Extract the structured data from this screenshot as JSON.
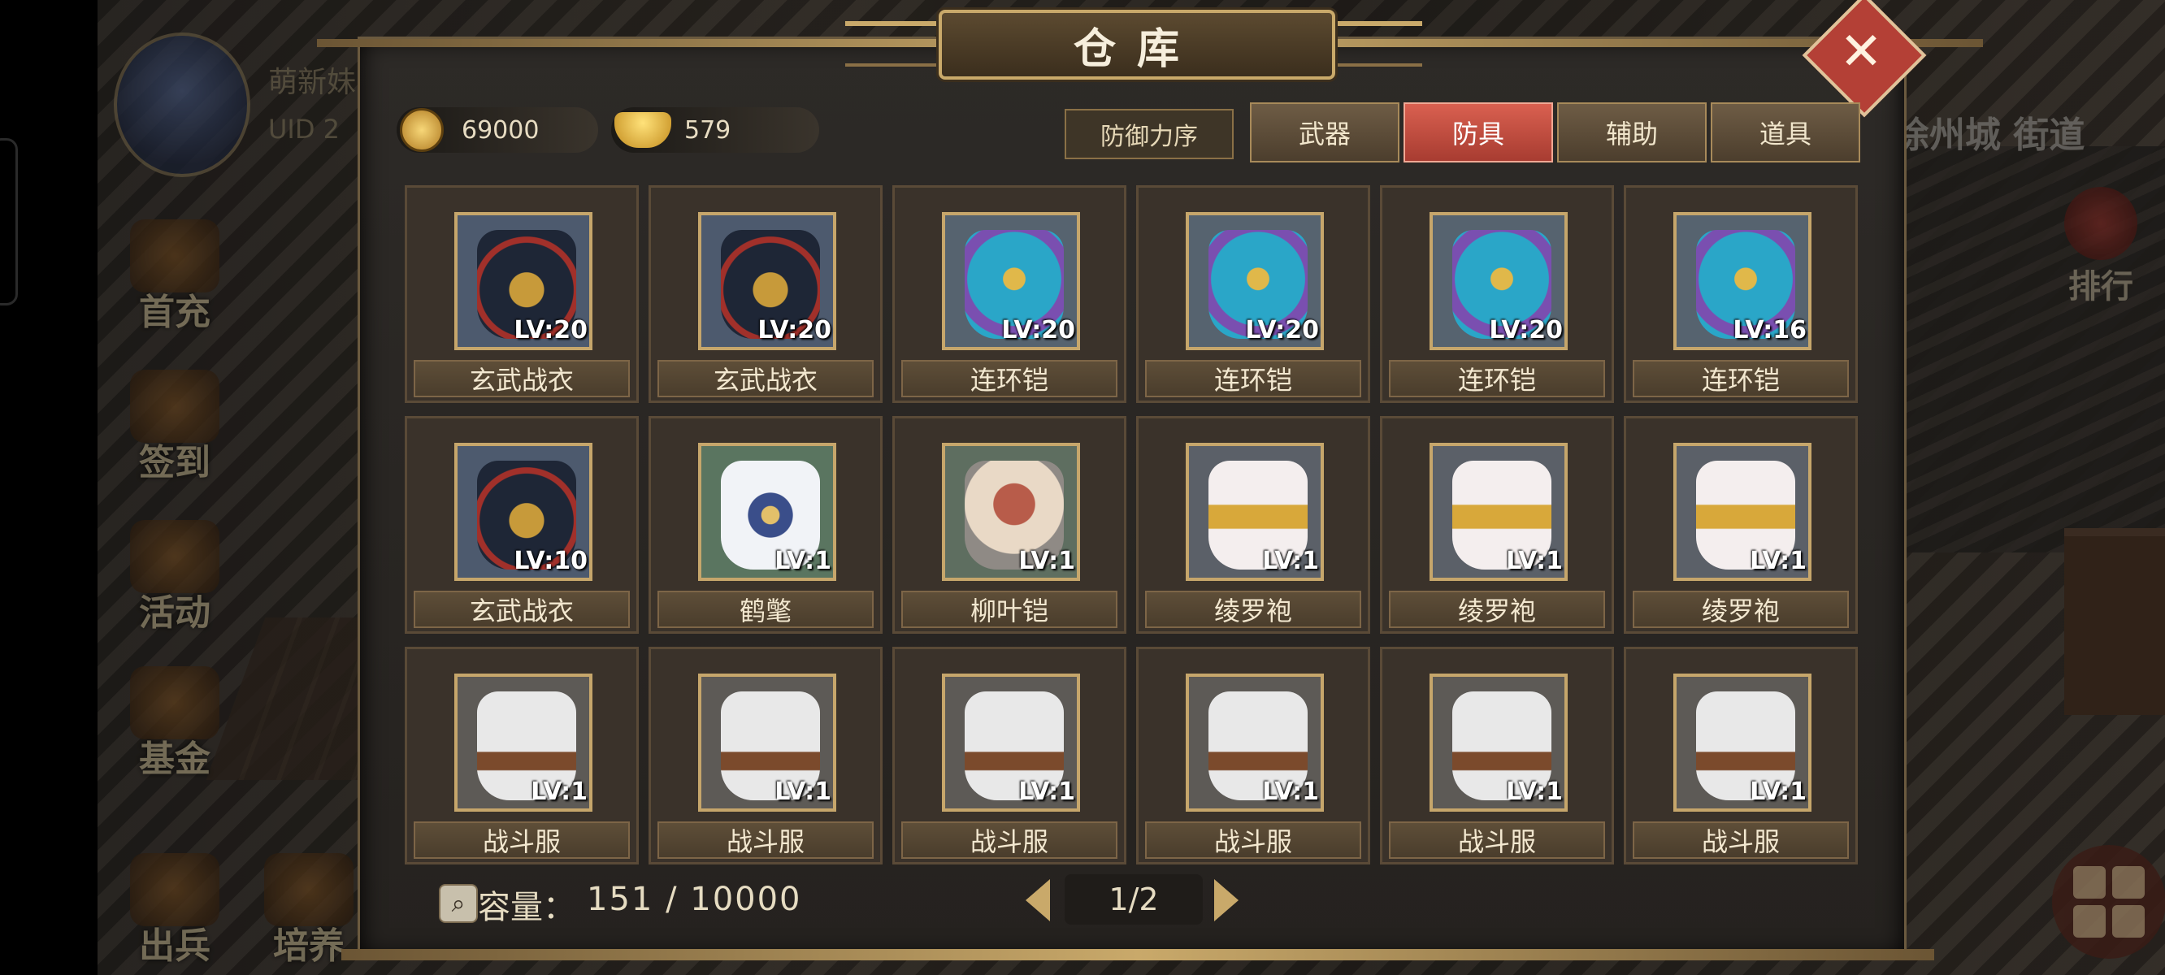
{
  "hud": {
    "player_name": "萌新妹",
    "player_uid": "UID 2",
    "side_buttons": [
      "首充",
      "签到",
      "活动",
      "基金",
      "出兵",
      "培养"
    ],
    "location": "徐州城 街道",
    "rank_label": "排行"
  },
  "modal": {
    "title": "仓库",
    "close_icon": "close-icon",
    "currency": {
      "coins": "69000",
      "ingots": "579"
    },
    "sort_label": "防御力序",
    "tabs": [
      {
        "label": "武器",
        "active": false
      },
      {
        "label": "防具",
        "active": true
      },
      {
        "label": "辅助",
        "active": false
      },
      {
        "label": "道具",
        "active": false
      }
    ],
    "items": [
      {
        "name": "玄武战衣",
        "level": "LV:20",
        "style": "xuanwu"
      },
      {
        "name": "玄武战衣",
        "level": "LV:20",
        "style": "xuanwu"
      },
      {
        "name": "连环铠",
        "level": "LV:20",
        "style": "lianhuan"
      },
      {
        "name": "连环铠",
        "level": "LV:20",
        "style": "lianhuan"
      },
      {
        "name": "连环铠",
        "level": "LV:20",
        "style": "lianhuan"
      },
      {
        "name": "连环铠",
        "level": "LV:16",
        "style": "lianhuan"
      },
      {
        "name": "玄武战衣",
        "level": "LV:10",
        "style": "xuanwu"
      },
      {
        "name": "鹤氅",
        "level": "LV:1",
        "style": "hechang"
      },
      {
        "name": "柳叶铠",
        "level": "LV:1",
        "style": "liuye"
      },
      {
        "name": "绫罗袍",
        "level": "LV:1",
        "style": "lingluo"
      },
      {
        "name": "绫罗袍",
        "level": "LV:1",
        "style": "lingluo"
      },
      {
        "name": "绫罗袍",
        "level": "LV:1",
        "style": "lingluo"
      },
      {
        "name": "战斗服",
        "level": "LV:1",
        "style": "zhandou"
      },
      {
        "name": "战斗服",
        "level": "LV:1",
        "style": "zhandou"
      },
      {
        "name": "战斗服",
        "level": "LV:1",
        "style": "zhandou"
      },
      {
        "name": "战斗服",
        "level": "LV:1",
        "style": "zhandou"
      },
      {
        "name": "战斗服",
        "level": "LV:1",
        "style": "zhandou"
      },
      {
        "name": "战斗服",
        "level": "LV:1",
        "style": "zhandou"
      }
    ],
    "capacity_label": "容量：",
    "capacity_value": "151 / 10000",
    "page": "1/2"
  },
  "colors": {
    "active_tab": "#c8493c",
    "frame_gold": "#c9a96a",
    "panel_bg": "#2a2724"
  }
}
